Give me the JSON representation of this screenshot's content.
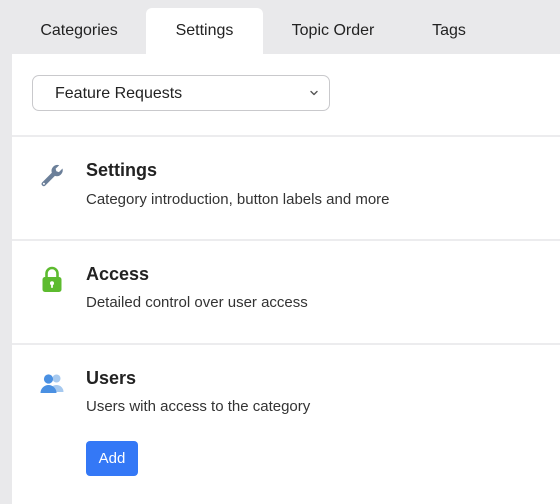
{
  "tabs": [
    {
      "label": "Categories"
    },
    {
      "label": "Settings"
    },
    {
      "label": "Topic Order"
    },
    {
      "label": "Tags"
    }
  ],
  "category_select": {
    "value": "Feature Requests"
  },
  "sections": {
    "settings": {
      "title": "Settings",
      "description": "Category introduction, button labels and more",
      "icon": "wrench-icon"
    },
    "access": {
      "title": "Access",
      "description": "Detailed control over user access",
      "icon": "lock-icon"
    },
    "users": {
      "title": "Users",
      "description": "Users with access to the category",
      "icon": "users-icon",
      "add_label": "Add"
    }
  },
  "colors": {
    "accent": "#3478f6",
    "lock": "#5dbb2f",
    "users_icon": "#4a90e2",
    "wrench_icon": "#6b7f99"
  }
}
